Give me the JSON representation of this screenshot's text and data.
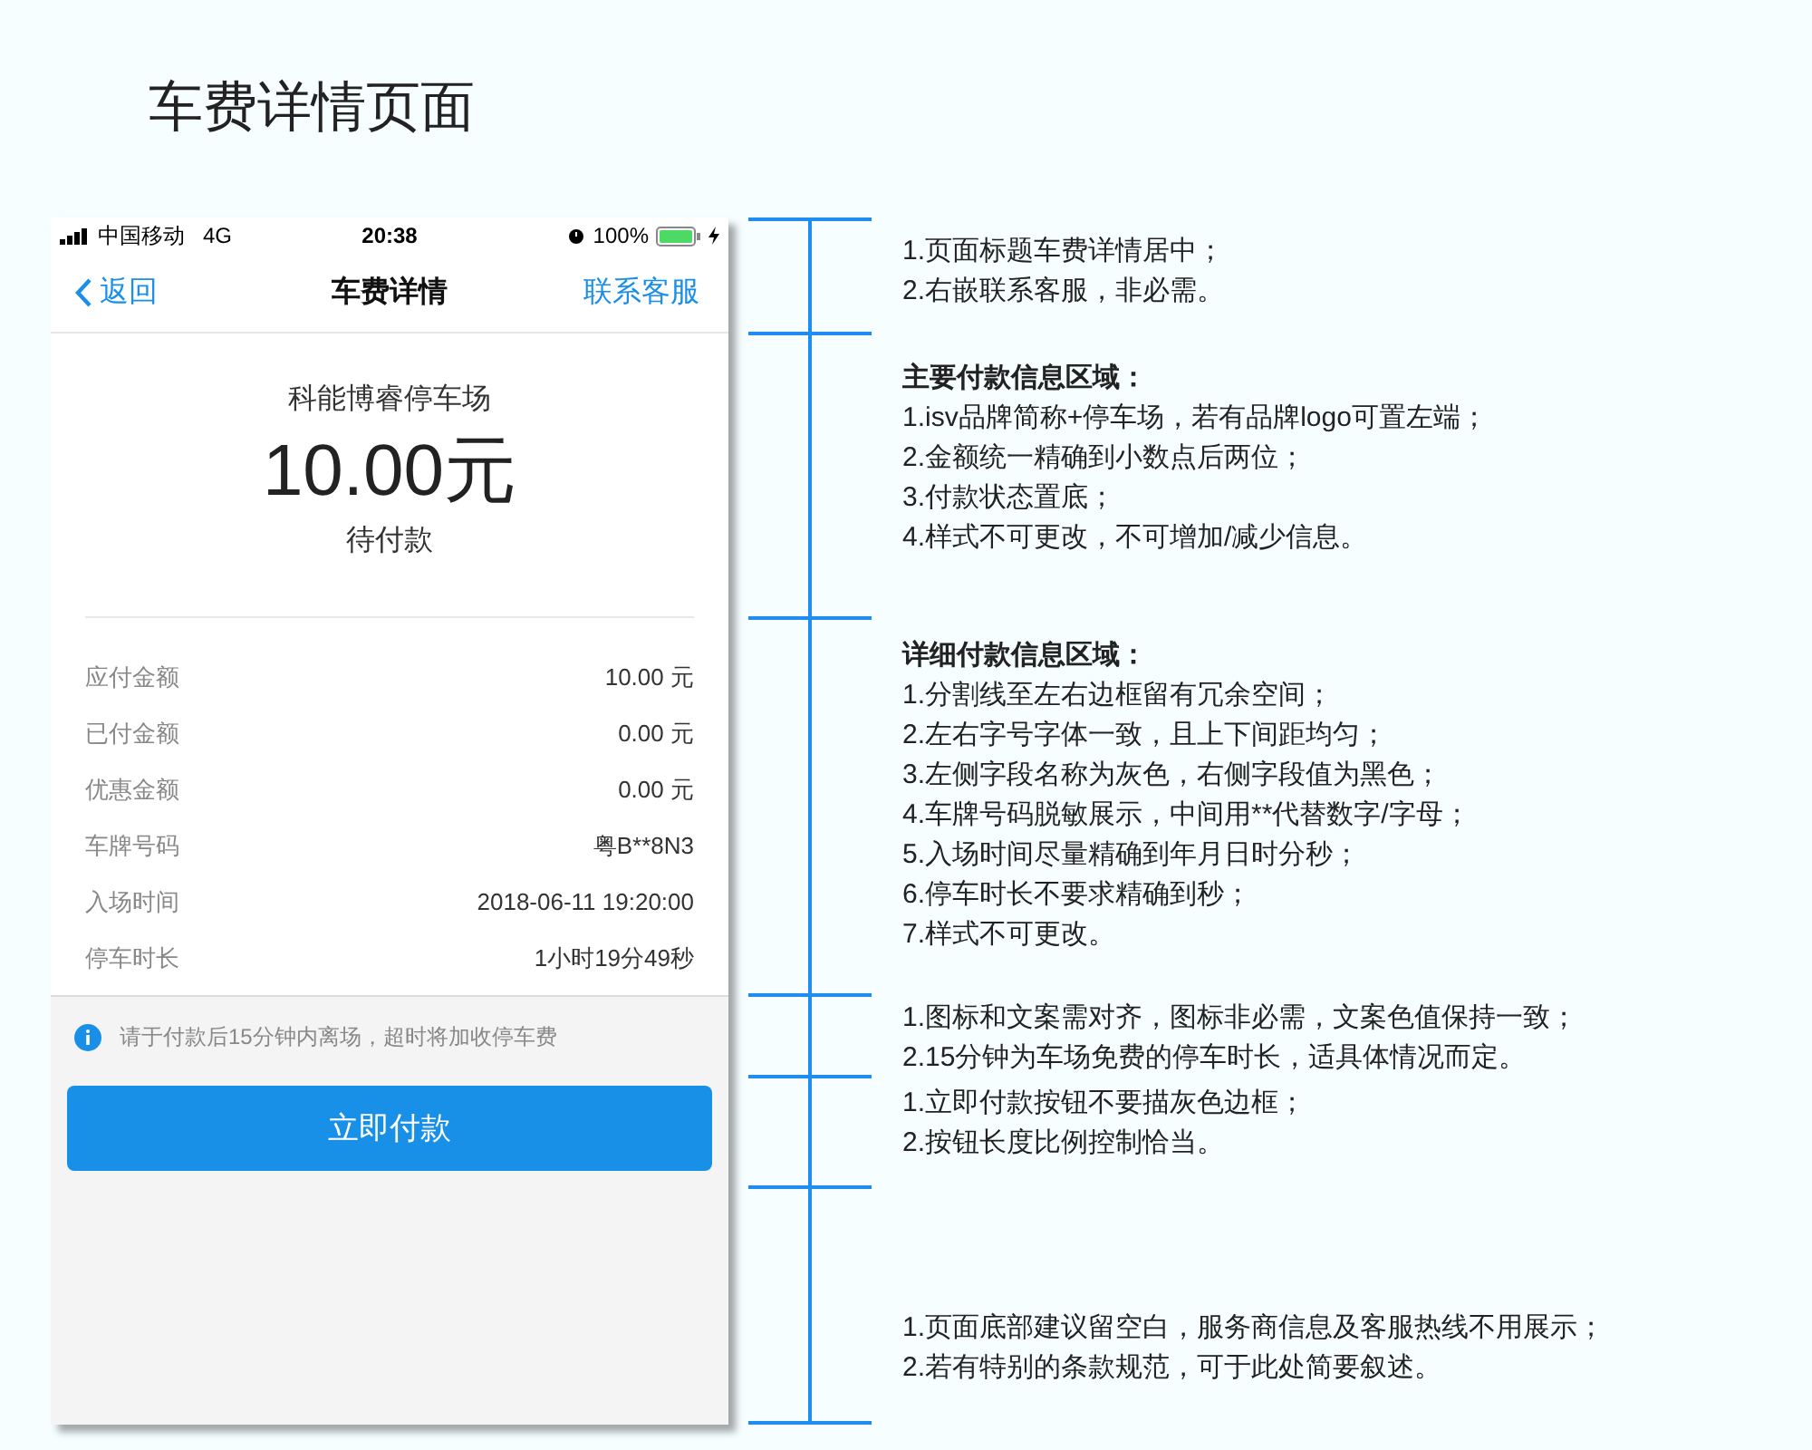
{
  "page_title": "车费详情页面",
  "phone": {
    "status_bar": {
      "carrier": "中国移动",
      "network": "4G",
      "time": "20:38",
      "battery": "100%"
    },
    "nav": {
      "back": "返回",
      "title": "车费详情",
      "action": "联系客服"
    },
    "summary": {
      "lot_name": "科能博睿停车场",
      "amount": "10.00元",
      "status": "待付款"
    },
    "details": [
      {
        "label": "应付金额",
        "value": "10.00 元"
      },
      {
        "label": "已付金额",
        "value": "0.00 元"
      },
      {
        "label": "优惠金额",
        "value": "0.00 元"
      },
      {
        "label": "车牌号码",
        "value": "粤B**8N3"
      },
      {
        "label": "入场时间",
        "value": "2018-06-11 19:20:00"
      },
      {
        "label": "停车时长",
        "value": "1小时19分49秒"
      }
    ],
    "tip": "请于付款后15分钟内离场，超时将加收停车费",
    "pay_button": "立即付款"
  },
  "annotations": [
    {
      "lines": [
        "1.页面标题车费详情居中；",
        "2.右嵌联系客服，非必需。"
      ]
    },
    {
      "heading": "主要付款信息区域：",
      "lines": [
        "1.isv品牌简称+停车场，若有品牌logo可置左端；",
        "2.金额统一精确到小数点后两位；",
        "3.付款状态置底；",
        "4.样式不可更改，不可增加/减少信息。"
      ]
    },
    {
      "heading": "详细付款信息区域：",
      "lines": [
        "1.分割线至左右边框留有冗余空间；",
        "2.左右字号字体一致，且上下间距均匀；",
        "3.左侧字段名称为灰色，右侧字段值为黑色；",
        "4.车牌号码脱敏展示，中间用**代替数字/字母；",
        "5.入场时间尽量精确到年月日时分秒；",
        "6.停车时长不要求精确到秒；",
        "7.样式不可更改。"
      ]
    },
    {
      "lines": [
        "1.图标和文案需对齐，图标非必需，文案色值保持一致；",
        "2.15分钟为车场免费的停车时长，适具体情况而定。"
      ]
    },
    {
      "lines": [
        "1.立即付款按钮不要描灰色边框；",
        "2.按钮长度比例控制恰当。"
      ]
    },
    {
      "lines": [
        "1.页面底部建议留空白，服务商信息及客服热线不用展示；",
        "2.若有特别的条款规范，可于此处简要叙述。"
      ]
    }
  ]
}
